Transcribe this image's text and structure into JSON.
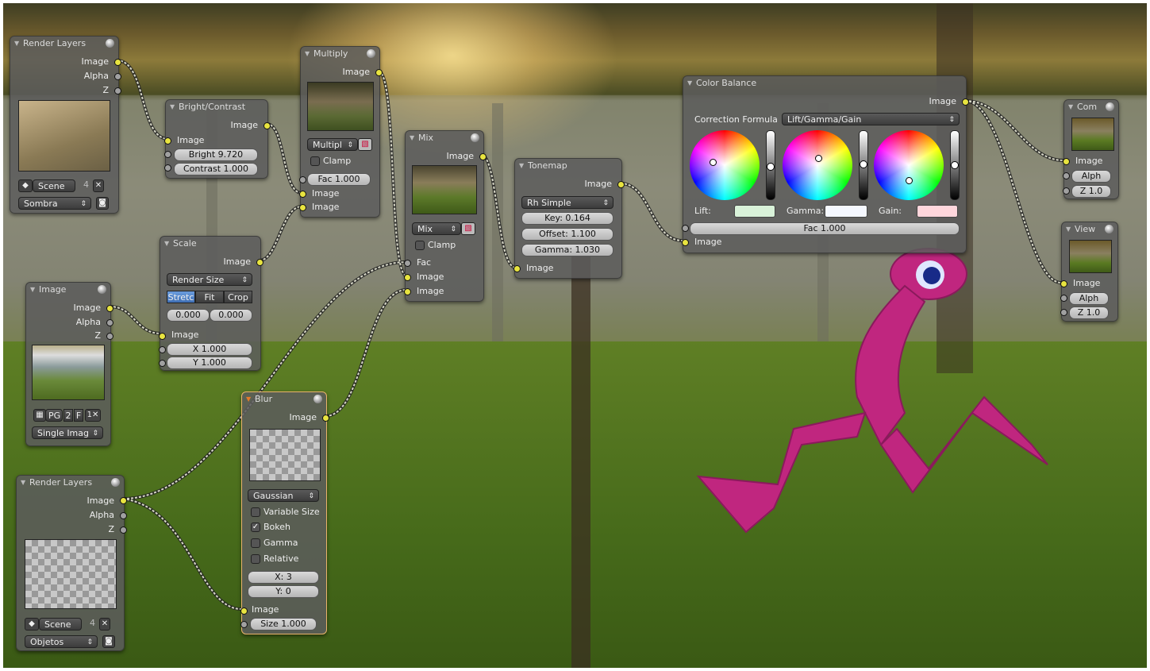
{
  "nodes": {
    "render_layers_1": {
      "title": "Render Layers",
      "out_image": "Image",
      "out_alpha": "Alpha",
      "out_z": "Z",
      "scene": "Scene",
      "layer_num": "4",
      "layer": "Sombra"
    },
    "bright_contrast": {
      "title": "Bright/Contrast",
      "out_image": "Image",
      "in_image": "Image",
      "bright": "Bright 9.720",
      "contrast": "Contrast 1.000"
    },
    "multiply": {
      "title": "Multiply",
      "out_image": "Image",
      "blend": "Multipl",
      "clamp": "Clamp",
      "fac": "Fac 1.000",
      "in_image1": "Image",
      "in_image2": "Image"
    },
    "mix": {
      "title": "Mix",
      "out_image": "Image",
      "blend": "Mix",
      "clamp": "Clamp",
      "in_fac": "Fac",
      "in_image1": "Image",
      "in_image2": "Image"
    },
    "tonemap": {
      "title": "Tonemap",
      "out_image": "Image",
      "type": "Rh Simple",
      "key": "Key: 0.164",
      "offset": "Offset: 1.100",
      "gamma": "Gamma: 1.030",
      "in_image": "Image"
    },
    "color_balance": {
      "title": "Color Balance",
      "out_image": "Image",
      "formula_label": "Correction Formula",
      "formula": "Lift/Gamma/Gain",
      "lift": "Lift:",
      "gamma": "Gamma:",
      "gain": "Gain:",
      "fac": "Fac 1.000",
      "in_image": "Image"
    },
    "composite": {
      "title": "Com",
      "in_image": "Image",
      "in_alpha": "Alph",
      "in_z": "Z 1.0"
    },
    "viewer": {
      "title": "View",
      "in_image": "Image",
      "in_alpha": "Alph",
      "in_z": "Z 1.0"
    },
    "scale": {
      "title": "Scale",
      "out_image": "Image",
      "space": "Render Size",
      "modes": [
        "Stretc",
        "Fit",
        "Crop"
      ],
      "off1": "0.000",
      "off2": "0.000",
      "in_image": "Image",
      "x": "X 1.000",
      "y": "Y 1.000"
    },
    "image": {
      "title": "Image",
      "out_image": "Image",
      "out_alpha": "Alpha",
      "out_z": "Z",
      "img_name": "PG",
      "users": "2",
      "f": "F",
      "source": "Single Imag"
    },
    "blur": {
      "title": "Blur",
      "out_image": "Image",
      "filter": "Gaussian",
      "variable_size": "Variable Size",
      "bokeh": "Bokeh",
      "gamma": "Gamma",
      "relative": "Relative",
      "x": "X: 3",
      "y": "Y: 0",
      "in_image": "Image",
      "size": "Size 1.000"
    },
    "render_layers_2": {
      "title": "Render Layers",
      "out_image": "Image",
      "out_alpha": "Alpha",
      "out_z": "Z",
      "scene": "Scene",
      "layer_num": "4",
      "layer": "Objetos"
    }
  },
  "colors": {
    "socket_image": "#e8e440",
    "socket_value": "#a0a0a0",
    "lift": "#d9f2d9",
    "gamma": "#f5f8ff",
    "gain": "#ffd6dc"
  }
}
